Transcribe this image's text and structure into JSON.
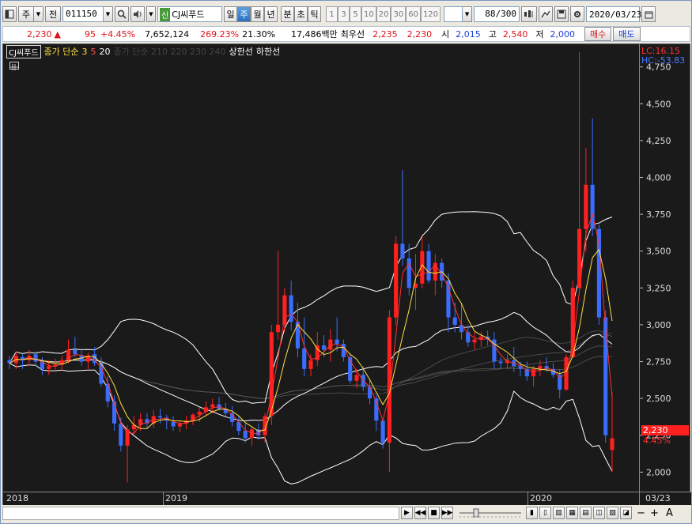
{
  "toolbar": {
    "type_label": "주",
    "jeon_label": "전",
    "code": "011150",
    "stock_tag": "신",
    "stock_name": "CJ씨푸드",
    "periods": [
      "일",
      "주",
      "월",
      "년",
      "분",
      "초",
      "틱"
    ],
    "active_period": "주",
    "intervals": [
      "1",
      "3",
      "5",
      "10",
      "20",
      "30",
      "60",
      "120"
    ],
    "count": "88",
    "count_max": "/300",
    "date": "2020/03/23"
  },
  "quote": {
    "price": "2,230",
    "arrow": "▲",
    "change": "95",
    "change_pct": "+4.45%",
    "volume": "7,652,124",
    "vol_ratio": "269.23%",
    "turnover": "21.30%",
    "amount": "17,486백만",
    "best_label": "최우선",
    "best_ask": "2,235",
    "best_bid": "2,230",
    "open_label": "시",
    "open": "2,015",
    "high_label": "고",
    "high": "2,540",
    "low_label": "저",
    "low": "2,000",
    "buy_label": "매수",
    "sell_label": "매도"
  },
  "legend": {
    "stock": "CJ씨푸드",
    "ma_title": "종가 단순",
    "ma3": "3",
    "ma5": "5",
    "ma20": "20",
    "hidden": "종가 단순 210 220 230 240",
    "upper": "상한선",
    "lower": "하한선"
  },
  "axis": {
    "lc": "LC:16.15",
    "hc": "HC:-53.83",
    "last_price": "2,230",
    "last_pct": "4.45%"
  },
  "dates": {
    "d2018": "2018",
    "d2019": "2019",
    "d2020": "2020",
    "last": "03/23"
  },
  "colors": {
    "up": "#ff2020",
    "down": "#3a6dff",
    "ma3": "#ff3030",
    "ma5": "#ffe040",
    "band": "#ffffff"
  },
  "chart_data": {
    "type": "candlestick",
    "title": "CJ씨푸드",
    "ylim": [
      1900,
      4850
    ],
    "yticks": [
      2000,
      2250,
      2500,
      2750,
      3000,
      3250,
      3500,
      3750,
      4000,
      4250,
      4500,
      4750
    ],
    "ytick_labels": [
      "2,000",
      "2,250",
      "2,500",
      "2,750",
      "3,000",
      "3,250",
      "3,500",
      "3,750",
      "4,000",
      "4,250",
      "4,500",
      "4,750"
    ],
    "x_labels": [
      "2018",
      "2019",
      "2020",
      "03/23"
    ],
    "last_close": 2230,
    "last_change_pct": 4.45,
    "candles": [
      [
        2760,
        2790,
        2700,
        2740
      ],
      [
        2740,
        2820,
        2700,
        2790
      ],
      [
        2780,
        2800,
        2700,
        2760
      ],
      [
        2760,
        2830,
        2720,
        2790
      ],
      [
        2800,
        2820,
        2720,
        2750
      ],
      [
        2750,
        2780,
        2660,
        2700
      ],
      [
        2700,
        2760,
        2660,
        2720
      ],
      [
        2720,
        2770,
        2680,
        2730
      ],
      [
        2730,
        2790,
        2690,
        2760
      ],
      [
        2760,
        2900,
        2740,
        2830
      ],
      [
        2830,
        2920,
        2780,
        2800
      ],
      [
        2790,
        2840,
        2720,
        2750
      ],
      [
        2750,
        2810,
        2700,
        2790
      ],
      [
        2800,
        2850,
        2720,
        2740
      ],
      [
        2740,
        2780,
        2580,
        2600
      ],
      [
        2600,
        2650,
        2440,
        2480
      ],
      [
        2480,
        2520,
        2280,
        2330
      ],
      [
        2330,
        2370,
        2140,
        2180
      ],
      [
        2180,
        2320,
        1930,
        2290
      ],
      [
        2290,
        2380,
        2260,
        2320
      ],
      [
        2320,
        2400,
        2280,
        2360
      ],
      [
        2360,
        2400,
        2300,
        2330
      ],
      [
        2330,
        2420,
        2300,
        2380
      ],
      [
        2380,
        2430,
        2330,
        2370
      ],
      [
        2370,
        2390,
        2290,
        2350
      ],
      [
        2340,
        2380,
        2280,
        2310
      ],
      [
        2310,
        2350,
        2270,
        2330
      ],
      [
        2330,
        2380,
        2290,
        2350
      ],
      [
        2350,
        2400,
        2320,
        2390
      ],
      [
        2390,
        2440,
        2340,
        2410
      ],
      [
        2410,
        2480,
        2380,
        2440
      ],
      [
        2440,
        2500,
        2400,
        2460
      ],
      [
        2460,
        2510,
        2420,
        2430
      ],
      [
        2430,
        2470,
        2380,
        2400
      ],
      [
        2400,
        2450,
        2310,
        2340
      ],
      [
        2340,
        2380,
        2250,
        2280
      ],
      [
        2280,
        2330,
        2200,
        2230
      ],
      [
        2230,
        2310,
        2180,
        2290
      ],
      [
        2290,
        2330,
        2220,
        2250
      ],
      [
        2250,
        2400,
        2200,
        2380
      ],
      [
        2380,
        3000,
        2320,
        2950
      ],
      [
        2950,
        3500,
        2900,
        3000
      ],
      [
        3000,
        3250,
        2950,
        3200
      ],
      [
        3200,
        3300,
        2960,
        3020
      ],
      [
        3020,
        3150,
        2780,
        2840
      ],
      [
        2840,
        3050,
        2650,
        2700
      ],
      [
        2700,
        2800,
        2650,
        2760
      ],
      [
        2760,
        2950,
        2720,
        2860
      ],
      [
        2860,
        2930,
        2780,
        2830
      ],
      [
        2830,
        2970,
        2750,
        2900
      ],
      [
        2900,
        3050,
        2820,
        2870
      ],
      [
        2870,
        2900,
        2750,
        2780
      ],
      [
        2780,
        2800,
        2600,
        2620
      ],
      [
        2620,
        2700,
        2570,
        2660
      ],
      [
        2660,
        2720,
        2550,
        2580
      ],
      [
        2580,
        2630,
        2460,
        2500
      ],
      [
        2500,
        2520,
        2280,
        2350
      ],
      [
        2350,
        2350,
        2160,
        2200
      ],
      [
        2200,
        3100,
        2000,
        3050
      ],
      [
        3050,
        3600,
        3000,
        3550
      ],
      [
        3550,
        4050,
        3400,
        3450
      ],
      [
        3450,
        3550,
        3200,
        3250
      ],
      [
        3250,
        3480,
        3100,
        3280
      ],
      [
        3280,
        3600,
        3250,
        3500
      ],
      [
        3500,
        3550,
        3280,
        3300
      ],
      [
        3300,
        3480,
        3200,
        3420
      ],
      [
        3420,
        3450,
        3250,
        3300
      ],
      [
        3300,
        3350,
        2950,
        3050
      ],
      [
        3050,
        3150,
        2950,
        3000
      ],
      [
        3000,
        3150,
        2900,
        2950
      ],
      [
        2950,
        3000,
        2850,
        2880
      ],
      [
        2880,
        2950,
        2830,
        2900
      ],
      [
        2900,
        2950,
        2850,
        2920
      ],
      [
        2920,
        2960,
        2860,
        2900
      ],
      [
        2900,
        2950,
        2700,
        2750
      ],
      [
        2750,
        2780,
        2700,
        2740
      ],
      [
        2740,
        2800,
        2700,
        2760
      ],
      [
        2760,
        2850,
        2680,
        2720
      ],
      [
        2720,
        2750,
        2650,
        2700
      ],
      [
        2700,
        2750,
        2620,
        2650
      ],
      [
        2650,
        2720,
        2580,
        2700
      ],
      [
        2700,
        2760,
        2650,
        2720
      ],
      [
        2720,
        2780,
        2680,
        2700
      ],
      [
        2700,
        2740,
        2640,
        2660
      ],
      [
        2660,
        2700,
        2500,
        2560
      ],
      [
        2560,
        2800,
        2550,
        2780
      ],
      [
        2780,
        3300,
        2780,
        3250
      ],
      [
        3250,
        4850,
        3250,
        3650
      ],
      [
        3650,
        4200,
        3500,
        3950
      ],
      [
        3950,
        4400,
        3600,
        3650
      ],
      [
        3650,
        3680,
        3000,
        3050
      ],
      [
        3050,
        3100,
        2200,
        2250
      ],
      [
        2150,
        2540,
        2000,
        2230
      ]
    ]
  }
}
